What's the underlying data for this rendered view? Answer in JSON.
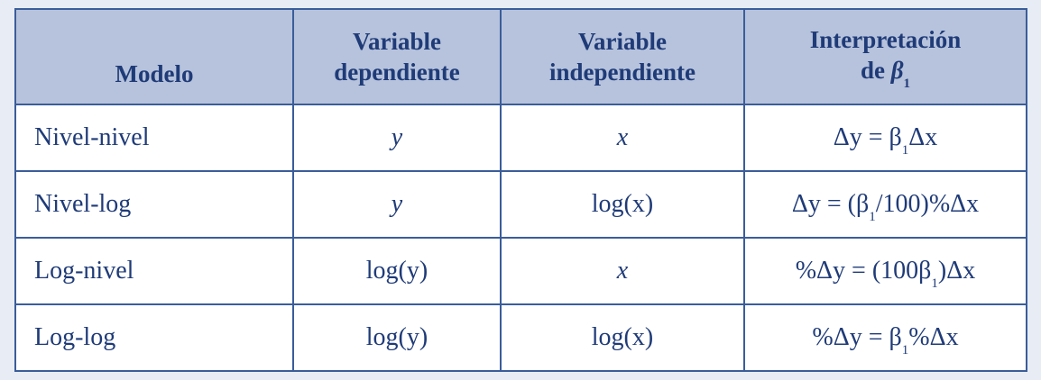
{
  "table": {
    "headers": {
      "modelo": "Modelo",
      "dependiente_line1": "Variable",
      "dependiente_line2": "dependiente",
      "independiente_line1": "Variable",
      "independiente_line2": "independiente",
      "interpretacion_line1": "Interpretación",
      "interpretacion_line2_prefix": "de ",
      "interpretacion_beta": "β",
      "interpretacion_sub": "1"
    },
    "rows": [
      {
        "modelo": "Nivel-nivel",
        "dependiente": "y",
        "independiente": "x",
        "interpretacion": {
          "a": "Δy = β",
          "sub": "1",
          "b": "Δx"
        }
      },
      {
        "modelo": "Nivel-log",
        "dependiente": "y",
        "independiente": "log(x)",
        "interpretacion": {
          "a": "Δy = (β",
          "sub": "1",
          "b": "/100)%Δx"
        }
      },
      {
        "modelo": "Log-nivel",
        "dependiente": "log(y)",
        "independiente": "x",
        "interpretacion": {
          "a": "%Δy = (100β",
          "sub": "1",
          "b": ")Δx"
        }
      },
      {
        "modelo": "Log-log",
        "dependiente": "log(y)",
        "independiente": "log(x)",
        "interpretacion": {
          "a": "%Δy = β",
          "sub": "1",
          "b": "%Δx"
        }
      }
    ]
  },
  "colors": {
    "text": "#1f3b78",
    "header_background": "#b7c3dc",
    "border": "#3a5d9a",
    "page_background": "#e8ecf5"
  }
}
